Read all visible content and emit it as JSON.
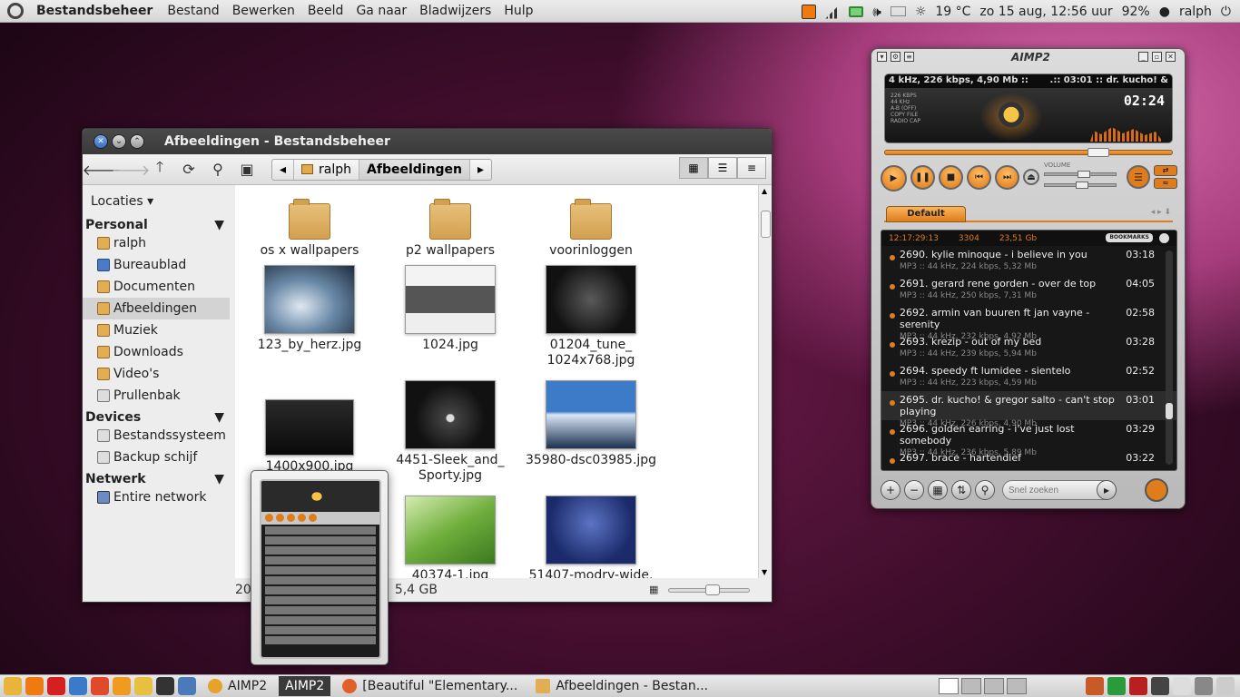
{
  "top_panel": {
    "app_name": "Bestandsbeheer",
    "menus": [
      "Bestand",
      "Bewerken",
      "Beeld",
      "Ga naar",
      "Bladwijzers",
      "Hulp"
    ],
    "weather": "19 °C",
    "datetime": "zo 15 aug, 12:56 uur",
    "battery": "92%",
    "user": "ralph",
    "volume_icon": "🕪"
  },
  "file_manager": {
    "title": "Afbeeldingen - Bestandsbeheer",
    "breadcrumbs": [
      "ralph",
      "Afbeeldingen"
    ],
    "sidebar": {
      "locations_label": "Locaties ▾",
      "sections": [
        {
          "name": "Personal",
          "items": [
            "ralph",
            "Bureaublad",
            "Documenten",
            "Afbeeldingen",
            "Muziek",
            "Downloads",
            "Video's",
            "Prullenbak"
          ]
        },
        {
          "name": "Devices",
          "items": [
            "Bestandssysteem",
            "Backup schijf"
          ]
        },
        {
          "name": "Netwerk",
          "items": [
            "Entire network"
          ]
        }
      ],
      "selected": "Afbeeldingen"
    },
    "items": [
      {
        "name": "os x wallpapers",
        "kind": "folder"
      },
      {
        "name": "p2 wallpapers",
        "kind": "folder"
      },
      {
        "name": "voorinloggen",
        "kind": "folder"
      },
      {
        "name": "123_by_herz.jpg",
        "kind": "image"
      },
      {
        "name": "1024.jpg",
        "kind": "image"
      },
      {
        "name": "01204_tune_\n1024x768.jpg",
        "kind": "image"
      },
      {
        "name": "1400x900.jpg",
        "kind": "image"
      },
      {
        "name": "4451-Sleek_and_\nSporty.jpg",
        "kind": "image"
      },
      {
        "name": "35980-dsc03985.jpg",
        "kind": "image"
      },
      {
        "name": "",
        "kind": "image"
      },
      {
        "name": "40374-1.jpg",
        "kind": "image"
      },
      {
        "name": "51407-modry-wide.",
        "kind": "image"
      }
    ],
    "status_left": "20",
    "status_right": "5,4 GB",
    "icon_colors": {
      "folder": "#d9a64f",
      "selection": "#d3d3d3"
    }
  },
  "aimp": {
    "title": "AIMP2",
    "info_left": "4 kHz, 226 kbps, 4,90 Mb ::",
    "info_right": ".:: 03:01 :: dr. kucho! &",
    "small_info": [
      "226 KBPS",
      "44 KHz",
      "A-B (OFF)",
      "COPY FILE",
      "RADIO CAP"
    ],
    "time": "02:24",
    "volume_label": "VOLUME",
    "progress": 0.74,
    "tab": "Default",
    "playlist_stats": [
      "12:17:29:13",
      "3304",
      "23,51 Gb"
    ],
    "bookmarks": "BOOKMARKS",
    "tracks": [
      {
        "title": "2690. kylie minoque - i believe in you",
        "time": "03:18",
        "meta": "MP3 :: 44 kHz, 224 kbps, 5,32 Mb"
      },
      {
        "title": "2691. gerard rene gorden - over de top",
        "time": "04:05",
        "meta": "MP3 :: 44 kHz, 250 kbps, 7,31 Mb"
      },
      {
        "title": "2692. armin van buuren ft jan vayne - serenity",
        "time": "02:58",
        "meta": "MP3 :: 44 kHz, 232 kbps, 4,92 Mb"
      },
      {
        "title": "2693. krezip - out of my bed",
        "time": "03:28",
        "meta": "MP3 :: 44 kHz, 239 kbps, 5,94 Mb"
      },
      {
        "title": "2694. speedy ft lumidee - sientelo",
        "time": "02:52",
        "meta": "MP3 :: 44 kHz, 223 kbps, 4,59 Mb"
      },
      {
        "title": "2695. dr. kucho! & gregor salto - can't stop playing",
        "time": "03:01",
        "meta": "MP3 :: 44 kHz, 226 kbps, 4,90 Mb"
      },
      {
        "title": "2696. golden earring - i've just lost somebody",
        "time": "03:29",
        "meta": "MP3 :: 44 kHz, 236 kbps, 5,89 Mb"
      },
      {
        "title": "2697. brace - hartendief",
        "time": "03:22",
        "meta": ""
      }
    ],
    "current_track": 5,
    "search_placeholder": "Snel zoeken",
    "accent": "#e07c1a"
  },
  "taskbar": {
    "tasks": [
      "AIMP2",
      "AIMP2",
      "[Beautiful \"Elementary...",
      "Afbeeldingen - Bestan..."
    ],
    "active_task": 1
  }
}
